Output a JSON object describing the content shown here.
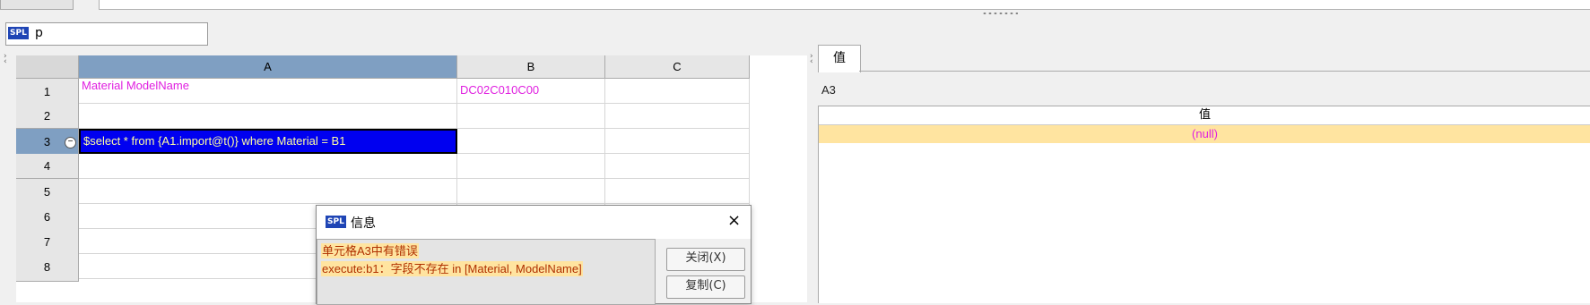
{
  "name_box": {
    "label": "p"
  },
  "grid": {
    "columns": [
      "A",
      "B",
      "C"
    ],
    "rows": [
      "1",
      "2",
      "3",
      "4",
      "5",
      "6",
      "7",
      "8"
    ],
    "cells": {
      "A1": "Material       ModelName",
      "B1": "DC02C010C00",
      "A3": "$select * from {A1.import@t()} where Material = B1"
    }
  },
  "value_panel": {
    "tab_label": "值",
    "cell_ref": "A3",
    "column_header": "值",
    "value": "(null)"
  },
  "dialog": {
    "title": "信息",
    "close_icon": "×",
    "message_line1": "单元格A3中有错误",
    "message_line2": "execute:b1：字段不存在 in [Material, ModelName]",
    "close_button": "关闭(X)",
    "copy_button": "复制(C)"
  },
  "colors": {
    "selected_header": "#7f9fc2",
    "active_cell": "#0000f0",
    "cell_text": "#e020e0",
    "highlight": "#ffe4a0"
  }
}
